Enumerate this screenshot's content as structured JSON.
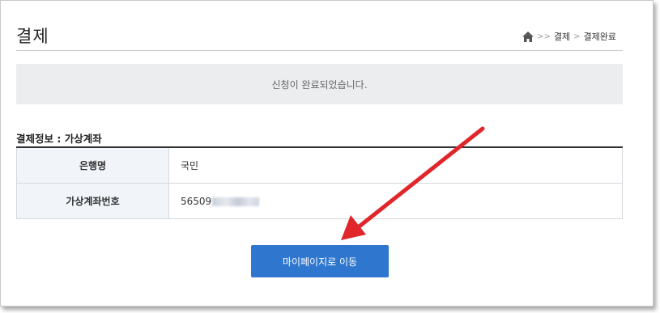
{
  "header": {
    "title": "결제",
    "breadcrumb": {
      "home_icon": "home-icon",
      "sep1": ">>",
      "item1": "결제",
      "sep2": ">",
      "item2": "결제완료"
    }
  },
  "notice": {
    "text": "신청이 완료되었습니다."
  },
  "payment_info": {
    "title": "결제정보 : 가상계좌",
    "rows": [
      {
        "label": "은행명",
        "value": "국민"
      },
      {
        "label": "가상계좌번호",
        "value": "56509"
      }
    ]
  },
  "actions": {
    "mypage_button": "마이페이지로 이동"
  },
  "annotation": {
    "arrow_color": "#e0262b"
  },
  "colors": {
    "button_bg": "#2f76cf",
    "notice_bg": "#ecedef",
    "table_header_bg": "#f1f4f8"
  }
}
